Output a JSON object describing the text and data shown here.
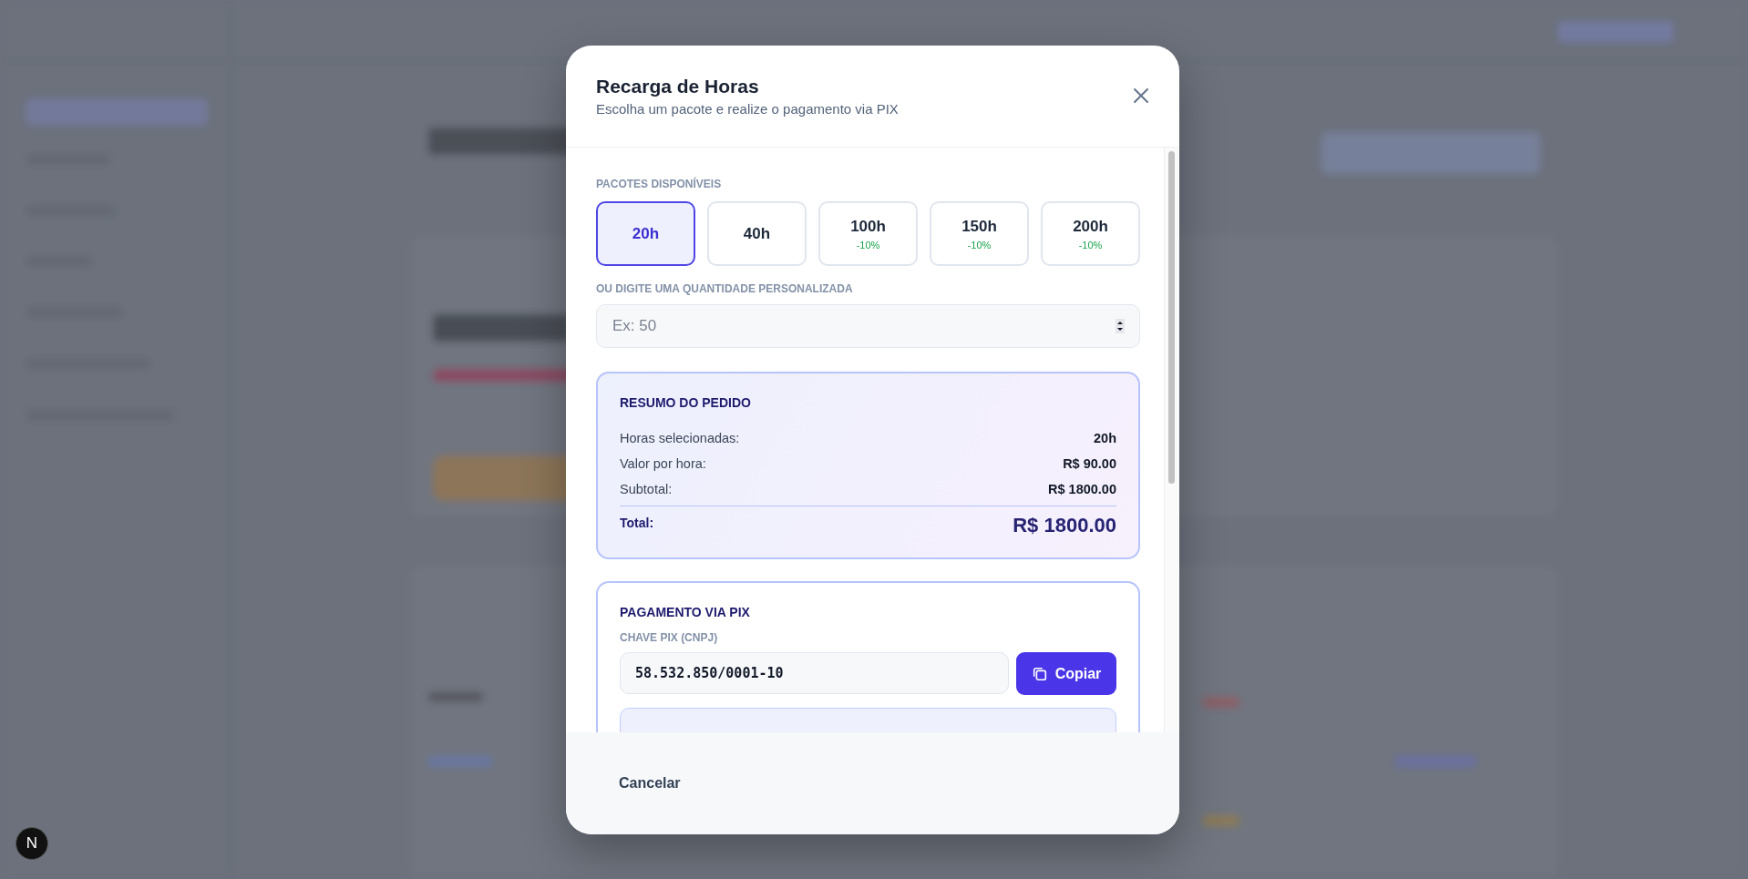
{
  "modal": {
    "title": "Recarga de Horas",
    "subtitle": "Escolha um pacote e realize o pagamento via PIX"
  },
  "packages_label": "PACOTES DISPONÍVEIS",
  "packages": [
    {
      "hours": "20h",
      "selected": true
    },
    {
      "hours": "40h",
      "selected": false
    },
    {
      "hours": "100h",
      "discount": "-10%",
      "selected": false
    },
    {
      "hours": "150h",
      "discount": "-10%",
      "selected": false
    },
    {
      "hours": "200h",
      "discount": "-10%",
      "selected": false
    }
  ],
  "custom": {
    "label": "OU DIGITE UMA QUANTIDADE PERSONALIZADA",
    "placeholder": "Ex: 50"
  },
  "summary": {
    "title": "RESUMO DO PEDIDO",
    "rows": [
      {
        "label": "Horas selecionadas:",
        "value": "20h"
      },
      {
        "label": "Valor por hora:",
        "value": "R$ 90.00"
      },
      {
        "label": "Subtotal:",
        "value": "R$ 1800.00"
      }
    ],
    "total_label": "Total:",
    "total_value": "R$ 1800.00"
  },
  "payment": {
    "title": "PAGAMENTO VIA PIX",
    "key_label": "CHAVE PIX (CNPJ)",
    "key_value": "58.532.850/0001-10",
    "copy_button": "Copiar"
  },
  "footer": {
    "cancel_button": "Cancelar"
  },
  "dev_badge": "N"
}
